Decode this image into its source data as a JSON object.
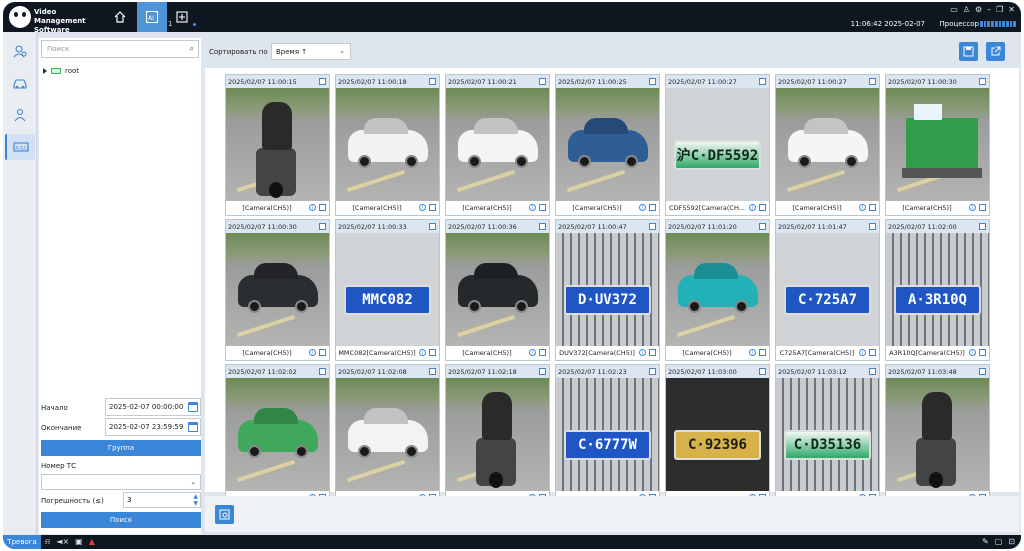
{
  "app": {
    "title": "Video Management Software"
  },
  "nav": {
    "tab_count": "1"
  },
  "status": {
    "datetime": "11:06:42 2025-02-07",
    "cpu_label": "Процессор"
  },
  "search": {
    "placeholder": "Поиск",
    "tree_root": "root"
  },
  "form": {
    "start_label": "Начало",
    "start_value": "2025-02-07 00:00:00",
    "end_label": "Окончание",
    "end_value": "2025-02-07 23:59:59",
    "group_button": "Группа",
    "plate_label": "Номер ТС",
    "plate_value": "",
    "tolerance_label": "Погрешность (≤)",
    "tolerance_value": "3",
    "search_button": "Поиск"
  },
  "sort": {
    "label": "Сортировать по",
    "value": "Время ↑"
  },
  "taskbar": {
    "alarm_label": "Тревога"
  },
  "cards": [
    {
      "time": "2025/02/07 11:00:15",
      "label": "[Camera(CH5)]",
      "kind": "rider"
    },
    {
      "time": "2025/02/07 11:00:18",
      "label": "[Camera(CH5)]",
      "kind": "car",
      "color": "#f2f2f2"
    },
    {
      "time": "2025/02/07 11:00:21",
      "label": "[Camera(CH5)]",
      "kind": "car",
      "color": "#f4f4f4"
    },
    {
      "time": "2025/02/07 11:00:25",
      "label": "[Camera(CH5)]",
      "kind": "car",
      "color": "#2f5d96"
    },
    {
      "time": "2025/02/07 11:00:27",
      "label": "CDF5592[Camera(CH...",
      "kind": "plate",
      "style": "green",
      "plate": "沪C·DF5592",
      "bg": "light"
    },
    {
      "time": "2025/02/07 11:00:27",
      "label": "[Camera(CH5)]",
      "kind": "car",
      "color": "#f5f5f5"
    },
    {
      "time": "2025/02/07 11:00:30",
      "label": "[Camera(CH5)]",
      "kind": "cart"
    },
    {
      "time": "2025/02/07 11:00:30",
      "label": "[Camera(CH5)]",
      "kind": "car",
      "color": "#2a2d31"
    },
    {
      "time": "2025/02/07 11:00:33",
      "label": "MMC082[Camera(CH5)]",
      "kind": "plate",
      "style": "blue",
      "plate": "MMC082",
      "bg": "light"
    },
    {
      "time": "2025/02/07 11:00:36",
      "label": "[Camera(CH5)]",
      "kind": "car",
      "color": "#26292c"
    },
    {
      "time": "2025/02/07 11:00:47",
      "label": "DUV372[Camera(CH5)]",
      "kind": "plate",
      "style": "blue",
      "plate": "D·UV372",
      "bg": "grille"
    },
    {
      "time": "2025/02/07 11:01:20",
      "label": "[Camera(CH5)]",
      "kind": "car",
      "color": "#23b1b8"
    },
    {
      "time": "2025/02/07 11:01:47",
      "label": "C725A7[Camera(CH5)]",
      "kind": "plate",
      "style": "blue",
      "plate": "C·725A7",
      "bg": "light"
    },
    {
      "time": "2025/02/07 11:02:00",
      "label": "A3R10Q[Camera(CH5)]",
      "kind": "plate",
      "style": "blue",
      "plate": "A·3R10Q",
      "bg": "grille"
    },
    {
      "time": "2025/02/07 11:02:02",
      "label": "",
      "kind": "car",
      "color": "#3fa85a"
    },
    {
      "time": "2025/02/07 11:02:08",
      "label": "",
      "kind": "car",
      "color": "#f3f3f3"
    },
    {
      "time": "2025/02/07 11:02:18",
      "label": "",
      "kind": "rider"
    },
    {
      "time": "2025/02/07 11:02:23",
      "label": "",
      "kind": "plate",
      "style": "blue",
      "plate": "C·6777W",
      "bg": "grille"
    },
    {
      "time": "2025/02/07 11:03:00",
      "label": "",
      "kind": "plate",
      "style": "yellow",
      "plate": "C·92396",
      "bg": "dark"
    },
    {
      "time": "2025/02/07 11:03:12",
      "label": "",
      "kind": "plate",
      "style": "green",
      "plate": "C·D35136",
      "bg": "grille"
    },
    {
      "time": "2025/02/07 11:03:48",
      "label": "",
      "kind": "rider"
    }
  ]
}
